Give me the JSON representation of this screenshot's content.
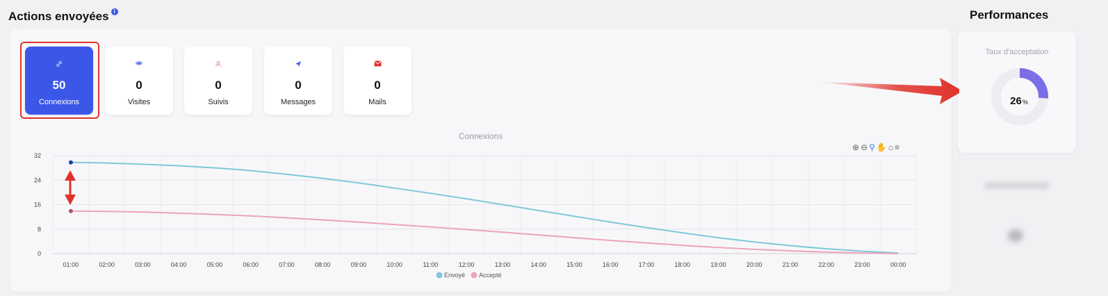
{
  "actions": {
    "title": "Actions envoyées",
    "info_icon": "info-icon"
  },
  "performances": {
    "title": "Performances",
    "acceptance_label": "Taux d'acceptation",
    "acceptance_value": "26",
    "acceptance_unit": "%",
    "acceptance_fraction": 0.26,
    "gauge_color": "#7b6ee8"
  },
  "cards": [
    {
      "value": "50",
      "label": "Connexions",
      "icon": "link-icon",
      "icon_color": "#ffffff",
      "active": true
    },
    {
      "value": "0",
      "label": "Visites",
      "icon": "eye-icon",
      "icon_color": "#5b7be8",
      "active": false
    },
    {
      "value": "0",
      "label": "Suivis",
      "icon": "user-icon",
      "icon_color": "#e08aa8",
      "active": false
    },
    {
      "value": "0",
      "label": "Messages",
      "icon": "send-icon",
      "icon_color": "#3b57e8",
      "active": false
    },
    {
      "value": "0",
      "label": "Mails",
      "icon": "mail-icon",
      "icon_color": "#e0322b",
      "active": false
    }
  ],
  "colors": {
    "accent": "#3b57e8",
    "highlight": "#e0322b"
  },
  "toolbar": [
    "zoom-in-icon",
    "zoom-out-icon",
    "zoom-selection-icon",
    "pan-icon",
    "home-icon",
    "menu-icon"
  ],
  "chart_data": {
    "type": "line",
    "title": "Connexions",
    "categories": [
      "01:00",
      "02:00",
      "03:00",
      "04:00",
      "05:00",
      "06:00",
      "07:00",
      "08:00",
      "09:00",
      "10:00",
      "11:00",
      "12:00",
      "13:00",
      "14:00",
      "15:00",
      "16:00",
      "17:00",
      "18:00",
      "19:00",
      "20:00",
      "21:00",
      "22:00",
      "23:00",
      "00:00"
    ],
    "y_ticks": [
      0,
      8,
      16,
      24,
      32
    ],
    "ylim": [
      0,
      32
    ],
    "grid": true,
    "legend": "bottom",
    "series": [
      {
        "name": "Envoyé",
        "color": "#7ec8d8",
        "values": [
          29.8,
          29.6,
          29.2,
          28.7,
          28.0,
          27.1,
          25.9,
          24.6,
          23.1,
          21.4,
          19.7,
          17.9,
          16.0,
          14.1,
          12.2,
          10.3,
          8.5,
          6.8,
          5.2,
          3.8,
          2.6,
          1.6,
          0.8,
          0.2
        ]
      },
      {
        "name": "Accepté",
        "color": "#eba4b8",
        "values": [
          13.9,
          13.8,
          13.6,
          13.2,
          12.8,
          12.3,
          11.7,
          11.0,
          10.3,
          9.5,
          8.7,
          7.9,
          7.0,
          6.1,
          5.2,
          4.3,
          3.5,
          2.7,
          2.0,
          1.4,
          0.9,
          0.5,
          0.2,
          0.0
        ]
      }
    ]
  }
}
